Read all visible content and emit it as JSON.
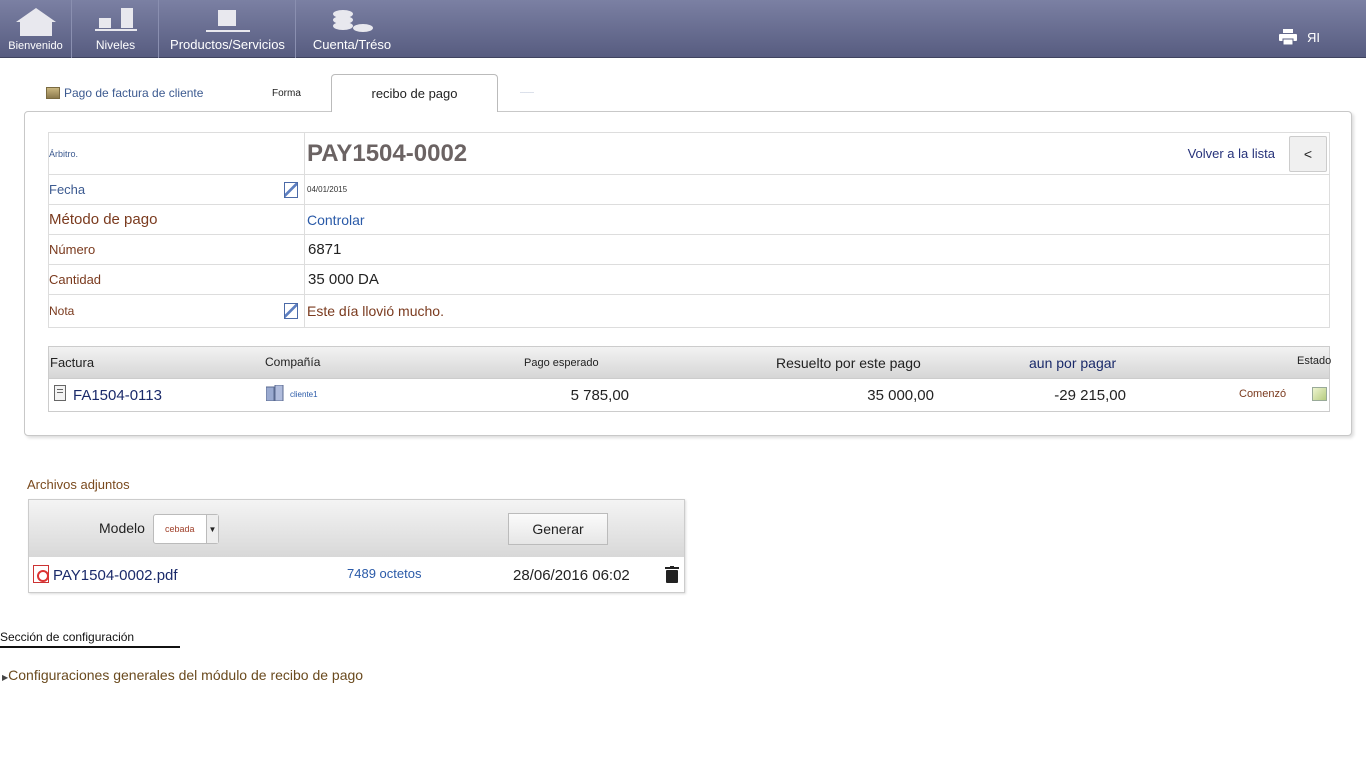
{
  "topbar": {
    "home": "Bienvenido",
    "levels": "Niveles",
    "products": "Productos/Servicios",
    "account": "Cuenta/Tréso",
    "user_initials": "ЯI"
  },
  "tabs": {
    "invoice_payment": "Pago de factura de cliente",
    "form": "Forma",
    "receipt": "recibo de pago"
  },
  "fields": {
    "ref_label": "Árbitro.",
    "ref_value": "PAY1504-0002",
    "back_link": "Volver a la lista",
    "back_button": "<",
    "date_label": "Fecha",
    "date_value": "04/01/2015",
    "method_label": "Método de pago",
    "method_value": "Controlar",
    "number_label": "Número",
    "number_value": "6871",
    "amount_label": "Cantidad",
    "amount_value": "35 000 DA",
    "note_label": "Nota",
    "note_value": "Este día llovió mucho."
  },
  "invoices": {
    "headers": {
      "invoice": "Factura",
      "company": "Compañía",
      "expected": "Pago esperado",
      "resolved": "Resuelto por este pago",
      "remaining": "aun por pagar",
      "status": "Estado"
    },
    "row": {
      "invoice": "FA1504-0113",
      "company": "cliente1",
      "expected": "5 785,00",
      "resolved": "35 000,00",
      "remaining": "-29 215,00",
      "status": "Comenzó"
    }
  },
  "attachments": {
    "title": "Archivos adjuntos",
    "model_label": "Modelo",
    "model_value": "cebada",
    "generate_button": "Generar",
    "file": {
      "name": "PAY1504-0002.pdf",
      "size": "7489 octetos",
      "date": "28/06/2016 06:02"
    }
  },
  "config": {
    "section_title": "Sección de configuración",
    "general_settings": "Configuraciones generales del módulo de recibo de pago"
  }
}
